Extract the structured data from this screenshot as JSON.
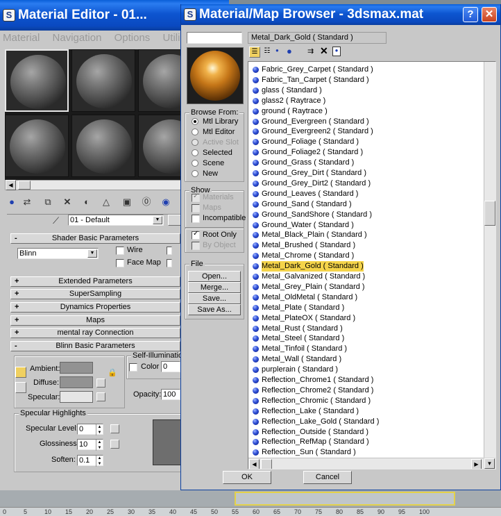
{
  "mat_editor": {
    "title": "Material Editor - 01...",
    "menu": [
      "Material",
      "Navigation",
      "Options",
      "Utili"
    ],
    "material_name": "01 - Default",
    "shader_rollout": "Shader Basic Parameters",
    "shader_type": "Blinn",
    "wire_label": "Wire",
    "face_map_label": "Face Map",
    "rollouts": [
      "Extended Parameters",
      "SuperSampling",
      "Dynamics Properties",
      "Maps",
      "mental ray Connection"
    ],
    "blinn_rollout": "Blinn Basic Parameters",
    "self_illum_label": "Self-Illumination",
    "color_label": "Color",
    "color_value": "0",
    "ambient_label": "Ambient:",
    "diffuse_label": "Diffuse:",
    "specular_label": "Specular:",
    "opacity_label": "Opacity:",
    "opacity_value": "100",
    "spec_highlights_label": "Specular Highlights",
    "spec_level_label": "Specular Level:",
    "spec_level_value": "0",
    "glossiness_label": "Glossiness:",
    "glossiness_value": "10",
    "soften_label": "Soften:",
    "soften_value": "0.1",
    "pm_minus": "-",
    "pm_plus": "+"
  },
  "browser": {
    "title": "Material/Map Browser - 3dsmax.mat",
    "help_glyph": "?",
    "close_glyph": "✕",
    "selected_name": "Metal_Dark_Gold  ( Standard )",
    "browse_from_label": "Browse From:",
    "browse_from": [
      {
        "label": "Mtl Library",
        "checked": true,
        "enabled": true
      },
      {
        "label": "Mtl Editor",
        "checked": false,
        "enabled": true
      },
      {
        "label": "Active Slot",
        "checked": false,
        "enabled": false
      },
      {
        "label": "Selected",
        "checked": false,
        "enabled": true
      },
      {
        "label": "Scene",
        "checked": false,
        "enabled": true
      },
      {
        "label": "New",
        "checked": false,
        "enabled": true
      }
    ],
    "show_label": "Show",
    "show": [
      {
        "label": "Materials",
        "checked": true,
        "enabled": false
      },
      {
        "label": "Maps",
        "checked": false,
        "enabled": false
      },
      {
        "label": "Incompatible",
        "checked": false,
        "enabled": true
      }
    ],
    "root_only_label": "Root Only",
    "by_object_label": "By Object",
    "file_label": "File",
    "file_buttons": [
      "Open...",
      "Merge...",
      "Save...",
      "Save As..."
    ],
    "ok_label": "OK",
    "cancel_label": "Cancel",
    "items": [
      "Fabric_Grey_Carpet  ( Standard )",
      "Fabric_Tan_Carpet  ( Standard )",
      "glass  ( Standard )",
      "glass2  ( Raytrace )",
      "ground  ( Raytrace )",
      "Ground_Evergreen  ( Standard )",
      "Ground_Evergreen2  ( Standard )",
      "Ground_Foliage  ( Standard )",
      "Ground_Foliage2  ( Standard )",
      "Ground_Grass  ( Standard )",
      "Ground_Grey_Dirt  ( Standard )",
      "Ground_Grey_Dirt2  ( Standard )",
      "Ground_Leaves  ( Standard )",
      "Ground_Sand  ( Standard )",
      "Ground_SandShore  ( Standard )",
      "Ground_Water  ( Standard )",
      "Metal_Black_Plain  ( Standard )",
      "Metal_Brushed  ( Standard )",
      "Metal_Chrome  ( Standard )",
      "Metal_Dark_Gold  ( Standard )",
      "Metal_Galvanized  ( Standard )",
      "Metal_Grey_Plain  ( Standard )",
      "Metal_OldMetal  ( Standard )",
      "Metal_Plate  ( Standard )",
      "Metal_PlateOX  ( Standard )",
      "Metal_Rust  ( Standard )",
      "Metal_Steel  ( Standard )",
      "Metal_Tinfoil  ( Standard )",
      "Metal_Wall  ( Standard )",
      "purplerain  ( Standard )",
      "Reflection_Chrome1  ( Standard )",
      "Reflection_Chrome2  ( Standard )",
      "Reflection_Chromic  ( Standard )",
      "Reflection_Lake  ( Standard )",
      "Reflection_Lake_Gold  ( Standard )",
      "Reflection_Outside  ( Standard )",
      "Reflection_RefMap  ( Standard )",
      "Reflection_Sun  ( Standard )"
    ],
    "selected_index": 19
  },
  "timeline": {
    "ticks": [
      "0",
      "5",
      "10",
      "15",
      "20",
      "25",
      "30",
      "35",
      "40",
      "45",
      "50",
      "55",
      "60",
      "65",
      "70",
      "75",
      "80",
      "85",
      "90",
      "95",
      "100"
    ]
  }
}
